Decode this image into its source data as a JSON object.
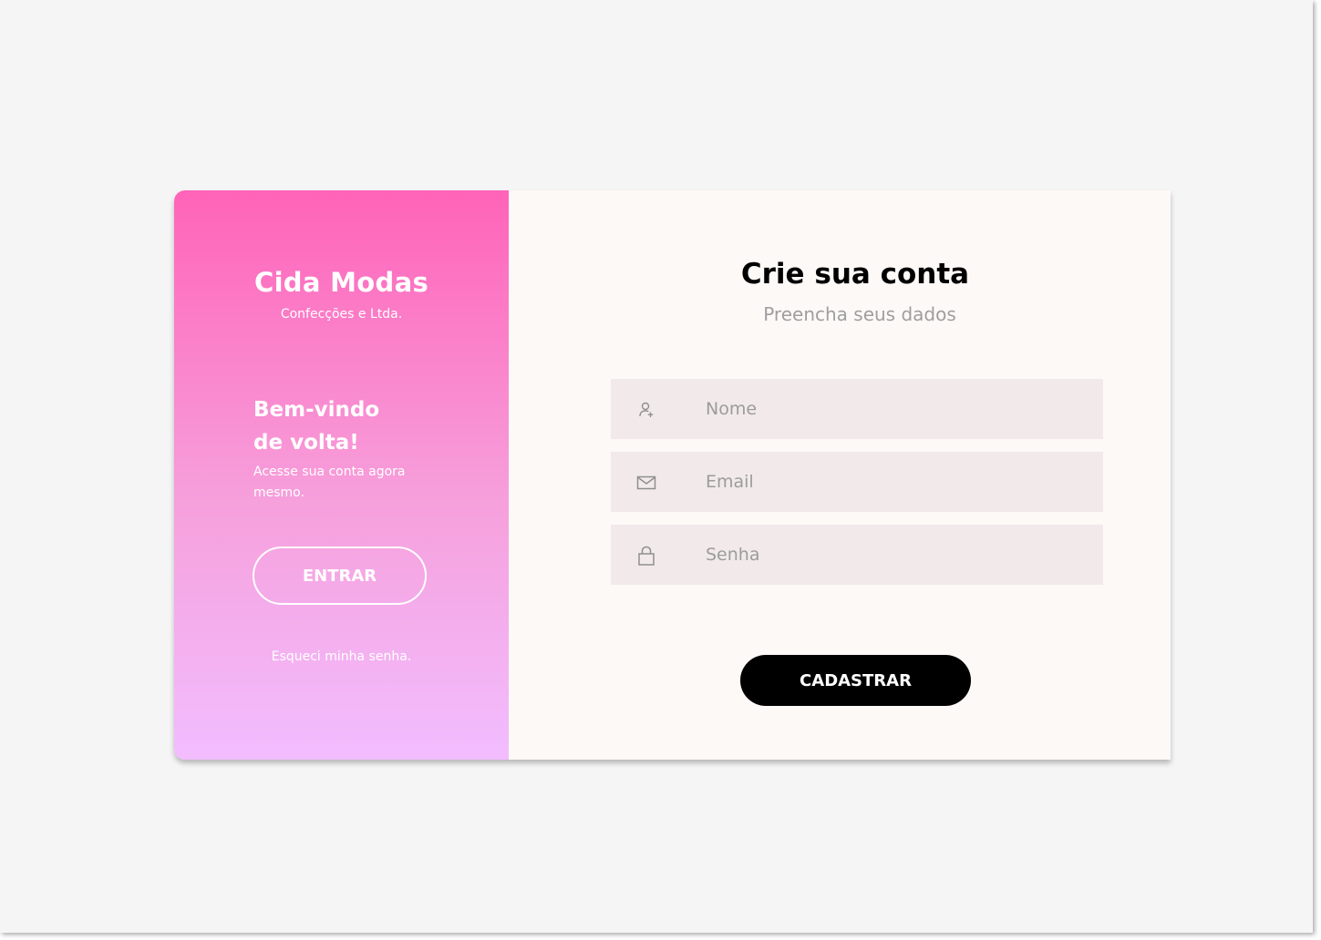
{
  "brand": {
    "name": "Cida Modas",
    "subtitle": "Confecções e Ltda."
  },
  "welcome": {
    "title_line1": "Bem-vindo",
    "title_line2": "de volta!",
    "text": "Acesse sua conta agora mesmo."
  },
  "login": {
    "button_label": "ENTRAR",
    "forgot_label": "Esqueci minha senha."
  },
  "signup": {
    "title": "Crie sua conta",
    "subtitle": "Preencha seus dados",
    "fields": {
      "name": {
        "placeholder": "Nome",
        "value": "",
        "icon": "user-add-icon"
      },
      "email": {
        "placeholder": "Email",
        "value": "",
        "icon": "mail-icon"
      },
      "password": {
        "placeholder": "Senha",
        "value": "",
        "icon": "lock-icon"
      }
    },
    "submit_label": "CADASTRAR"
  },
  "colors": {
    "gradient_top": "#ff63b8",
    "gradient_bottom": "#f2bdff",
    "field_background": "#f2eaea",
    "panel_background": "#fdf9f7",
    "button_background": "#000000"
  }
}
